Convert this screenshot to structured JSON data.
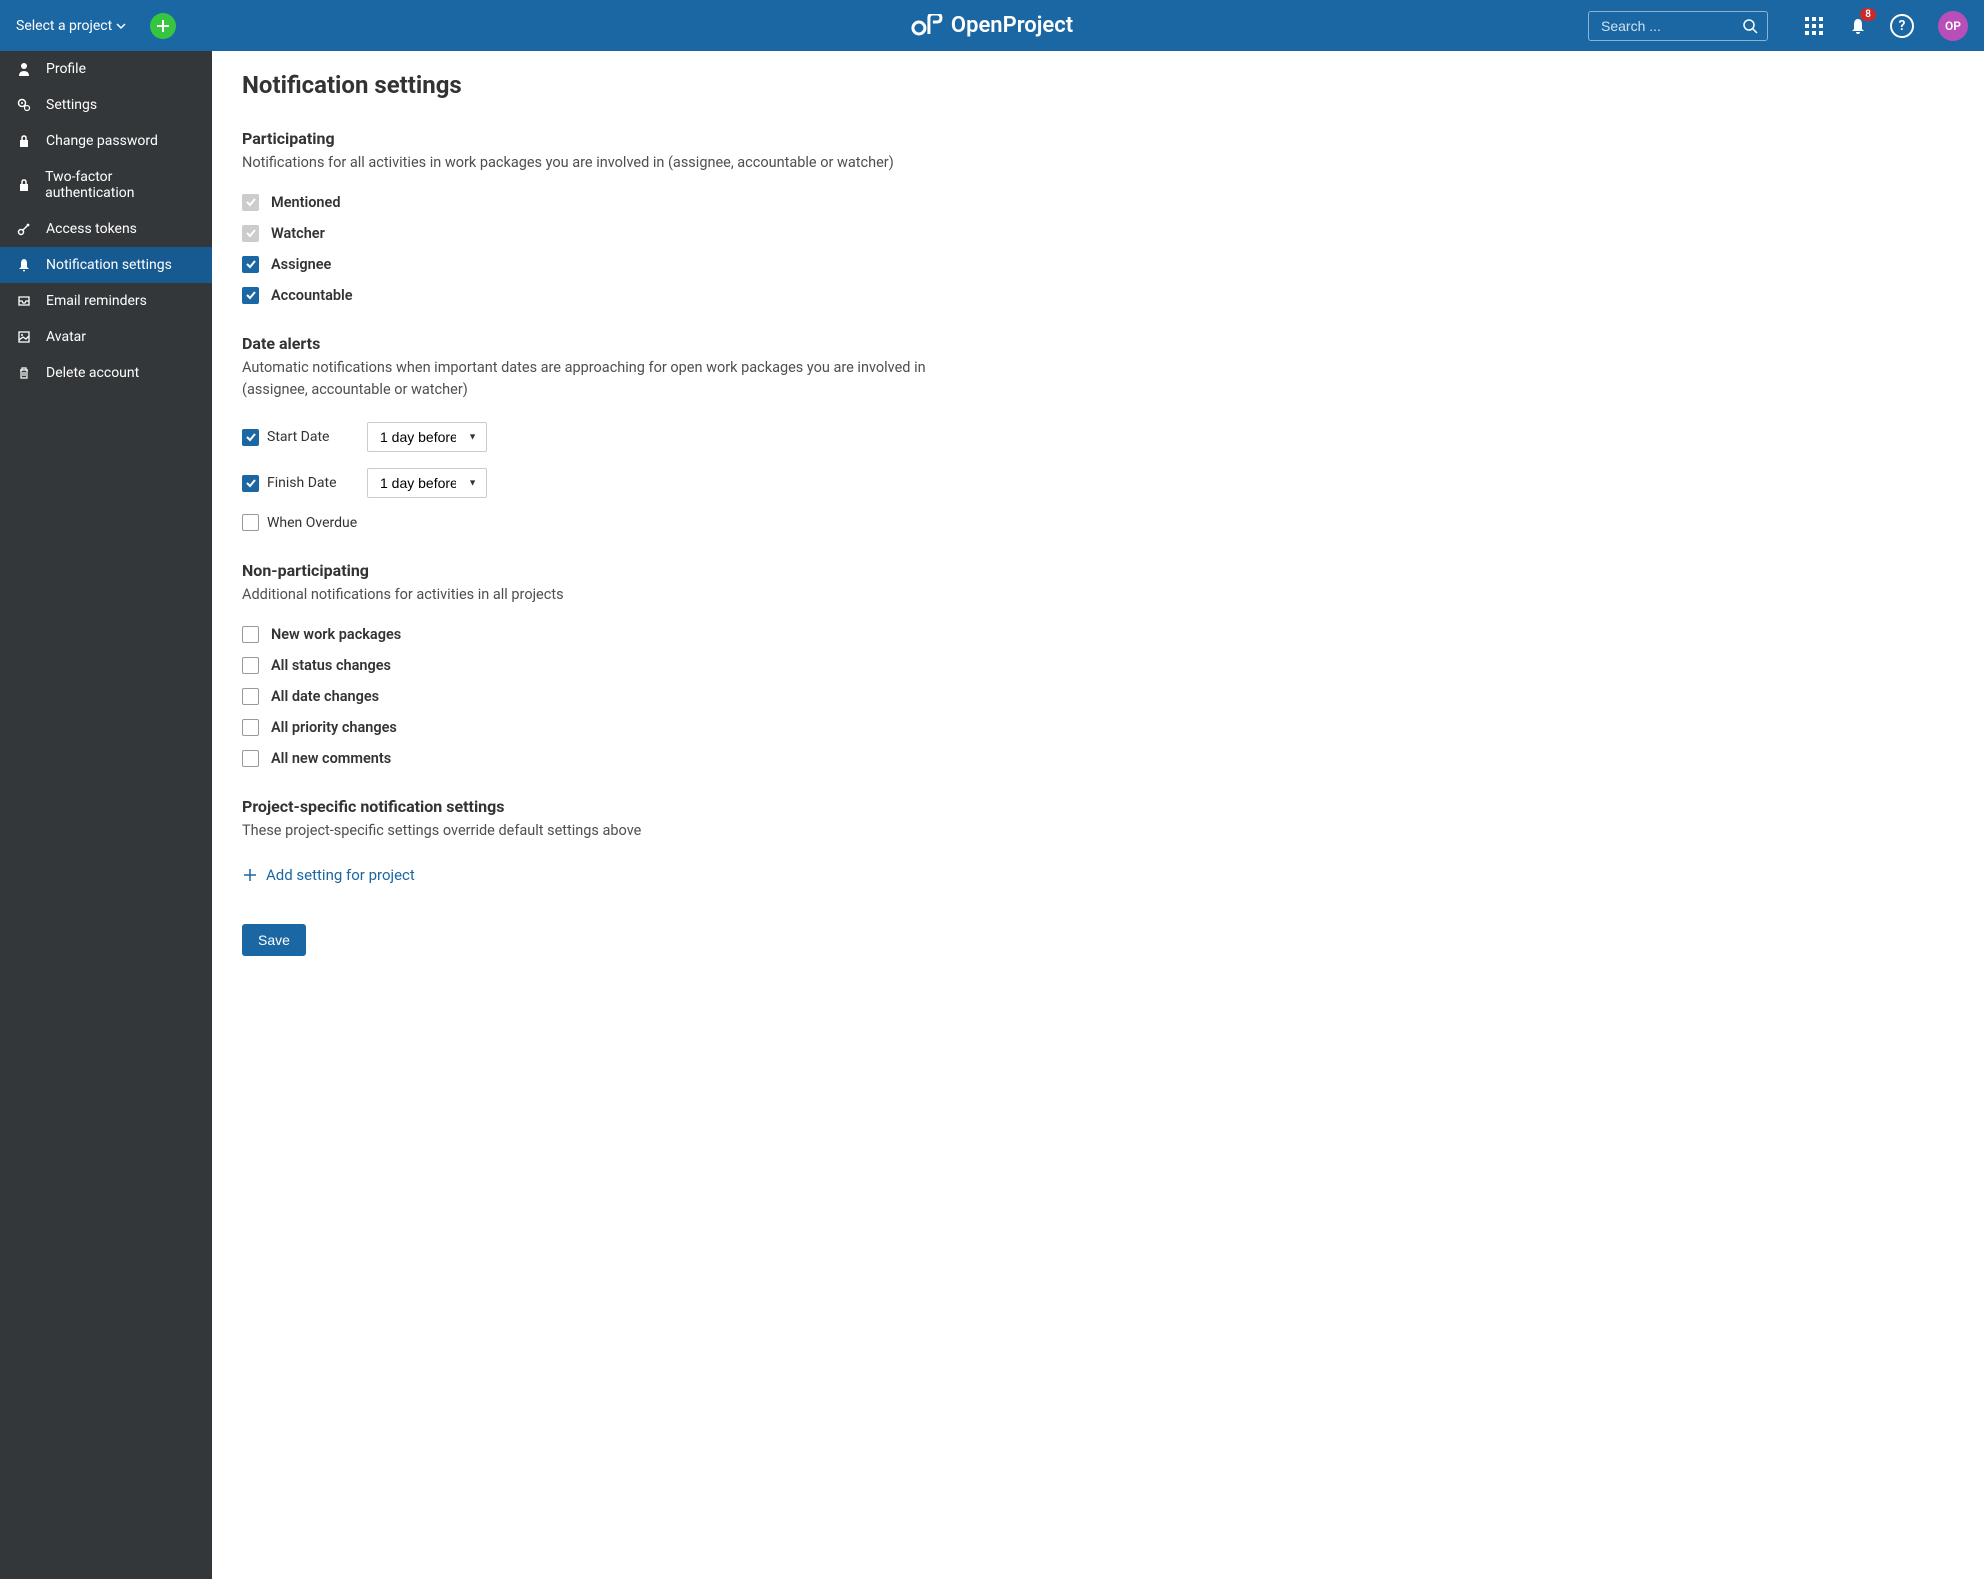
{
  "header": {
    "project_select": "Select a project",
    "search_placeholder": "Search ...",
    "notif_count": "8",
    "avatar_initials": "OP",
    "brand": "OpenProject"
  },
  "sidebar": {
    "items": [
      {
        "label": "Profile"
      },
      {
        "label": "Settings"
      },
      {
        "label": "Change password"
      },
      {
        "label": "Two-factor authentication"
      },
      {
        "label": "Access tokens"
      },
      {
        "label": "Notification settings"
      },
      {
        "label": "Email reminders"
      },
      {
        "label": "Avatar"
      },
      {
        "label": "Delete account"
      }
    ]
  },
  "page": {
    "title": "Notification settings",
    "sections": {
      "participating": {
        "heading": "Participating",
        "desc": "Notifications for all activities in work packages you are involved in (assignee, accountable or watcher)",
        "mentioned": "Mentioned",
        "watcher": "Watcher",
        "assignee": "Assignee",
        "accountable": "Accountable"
      },
      "date_alerts": {
        "heading": "Date alerts",
        "desc": "Automatic notifications when important dates are approaching for open work packages you are involved in (assignee, accountable or watcher)",
        "start_date": "Start Date",
        "finish_date": "Finish Date",
        "when_overdue": "When Overdue",
        "day_before": "1 day before"
      },
      "non_participating": {
        "heading": "Non-participating",
        "desc": "Additional notifications for activities in all projects",
        "new_wp": "New work packages",
        "status": "All status changes",
        "date": "All date changes",
        "priority": "All priority changes",
        "comments": "All new comments"
      },
      "project_specific": {
        "heading": "Project-specific notification settings",
        "desc": "These project-specific settings override default settings above",
        "add_link": "Add setting for project"
      }
    },
    "save_btn": "Save"
  }
}
